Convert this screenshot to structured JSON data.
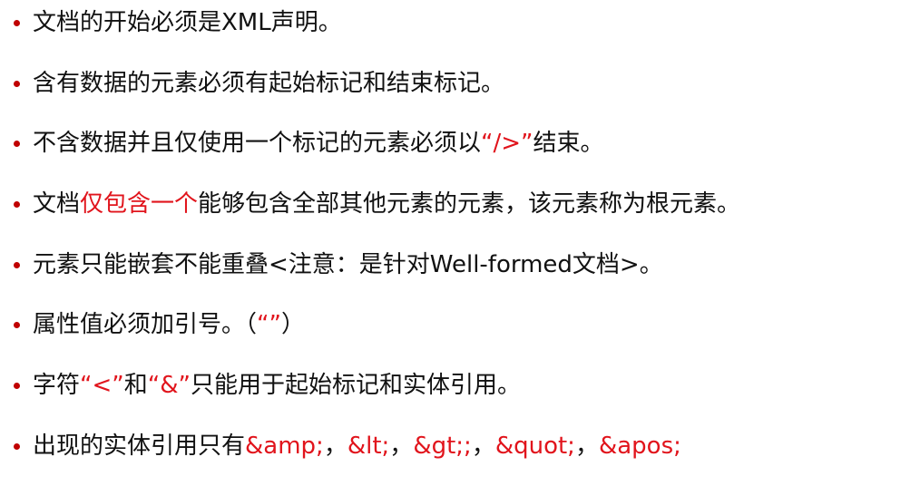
{
  "colors": {
    "text": "#111111",
    "highlight": "#e1141c",
    "bullet": "#c00000"
  },
  "items": [
    {
      "parts": [
        {
          "text": "文档的开始必须是XML声明。",
          "color": "text"
        }
      ]
    },
    {
      "parts": [
        {
          "text": "含有数据的元素必须有起始标记和结束标记。",
          "color": "text"
        }
      ]
    },
    {
      "parts": [
        {
          "text": "不含数据并且仅使用一个标记的元素必须以",
          "color": "text"
        },
        {
          "text": "“/>”",
          "color": "highlight"
        },
        {
          "text": "结束。",
          "color": "text"
        }
      ]
    },
    {
      "parts": [
        {
          "text": "文档",
          "color": "text"
        },
        {
          "text": "仅包含一个",
          "color": "highlight"
        },
        {
          "text": "能够包含全部其他元素的元素，该元素称为根元素。",
          "color": "text"
        }
      ]
    },
    {
      "parts": [
        {
          "text": "元素只能嵌套不能重叠<注意：是针对Well-formed文档>。",
          "color": "text"
        }
      ]
    },
    {
      "parts": [
        {
          "text": " 属性值必须加引号。（",
          "color": "text"
        },
        {
          "text": "“”",
          "color": "highlight"
        },
        {
          "text": "）",
          "color": "text"
        }
      ]
    },
    {
      "parts": [
        {
          "text": "字符",
          "color": "text"
        },
        {
          "text": "“<”",
          "color": "highlight"
        },
        {
          "text": "和",
          "color": "text"
        },
        {
          "text": "“&”",
          "color": "highlight"
        },
        {
          "text": "只能用于起始标记和实体引用。",
          "color": "text"
        }
      ]
    },
    {
      "parts": [
        {
          "text": "出现的实体引用只有",
          "color": "text"
        },
        {
          "text": "&amp;",
          "color": "highlight"
        },
        {
          "text": "，",
          "color": "text"
        },
        {
          "text": "&lt;",
          "color": "highlight"
        },
        {
          "text": "，",
          "color": "text"
        },
        {
          "text": "&gt;;",
          "color": "highlight"
        },
        {
          "text": "，",
          "color": "text"
        },
        {
          "text": "&quot;",
          "color": "highlight"
        },
        {
          "text": "，",
          "color": "text"
        },
        {
          "text": "&apos;",
          "color": "highlight"
        }
      ]
    }
  ]
}
